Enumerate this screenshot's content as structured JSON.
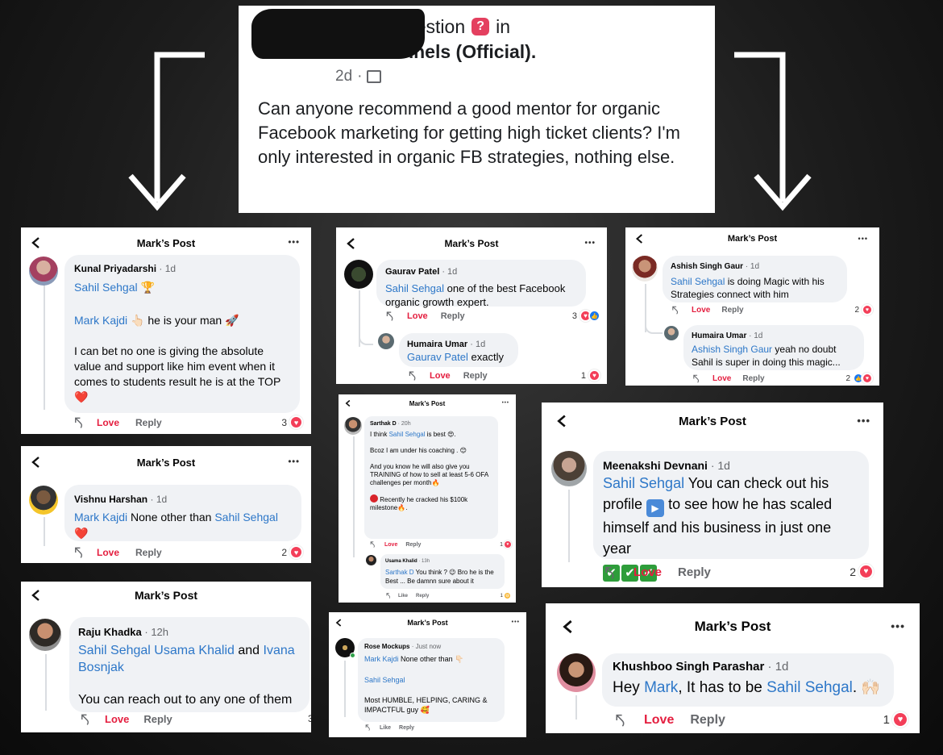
{
  "question": {
    "author_suffix": "sked a question",
    "in_text": "in",
    "group": "ClickFunnels (Official).",
    "age": "2d",
    "body": "Can anyone recommend a good mentor for organic Facebook marketing for getting high ticket clients? I'm only interested in organic FB strategies, nothing else."
  },
  "post_title": "Mark’s Post",
  "more_label": "•••",
  "love_label": "Love",
  "reply_label": "Reply",
  "like_label": "Like",
  "cards": {
    "kunal": {
      "name": "Kunal Priyadarshi",
      "time": "· 1d",
      "mention1": "Sahil Sehgal",
      "emoji1": "🏆",
      "mention2": "Mark Kajdi",
      "text2": "👆🏻 he is your man 🚀",
      "text3": "I can bet no one is giving the absolute value and support like him event when it comes to students result he is at the TOP ❤️",
      "count": "3"
    },
    "vishnu": {
      "name": "Vishnu Harshan",
      "time": "· 1d",
      "mention1": "Mark Kajdi",
      "text": "None other than",
      "mention2": "Sahil Sehgal",
      "emoji": "❤️",
      "count": "2"
    },
    "raju": {
      "name": "Raju Khadka",
      "time": "· 12h",
      "mention1": "Sahil Sehgal",
      "mention2": "Usama Khalid",
      "and_text": "and",
      "mention3": "Ivana Bosnjak",
      "text": "You can reach out to any one of them",
      "count": "3"
    },
    "gaurav": {
      "name": "Gaurav Patel",
      "time": "· 1d",
      "mention": "Sahil Sehgal",
      "text": "one of the best Facebook organic growth expert.",
      "count": "3",
      "reply_name": "Humaira Umar",
      "reply_time": "· 1d",
      "reply_mention": "Gaurav Patel",
      "reply_text": "exactly",
      "reply_count": "1"
    },
    "sarthak": {
      "name": "Sarthak D",
      "time": "· 20h",
      "t1a": "I think",
      "t1m": "Sahil Sehgal",
      "t1b": "is best 😍.",
      "t2": "Bcoz I am under his coaching . 😊",
      "t3": "And you know he will also give you TRAINING of how to sell at least 5-6 OFA challenges per month🔥",
      "t4": "Recently he cracked his $100k milestone🔥.",
      "count": "1",
      "reply_name": "Usama Khalid",
      "reply_time": "· 13h",
      "reply_mention": "Sarthak D",
      "reply_text": "You think ? 😉 Bro he is the Best ... Be damnn sure about it",
      "reply_count": "1"
    },
    "rose": {
      "name": "Rose Mockups",
      "time": "· Just now",
      "mention1": "Mark Kajdi",
      "text1": "None other than 👇🏻",
      "mention2": "Sahil Sehgal",
      "text2": "Most HUMBLE, HELPING, CARING & IMPACTFUL guy 🥰"
    },
    "ashish": {
      "name": "Ashish Singh Gaur",
      "time": "· 1d",
      "mention": "Sahil Sehgal",
      "text": "is doing Magic with his Strategies connect with him",
      "count": "2",
      "reply_name": "Humaira Umar",
      "reply_time": "· 1d",
      "reply_mention": "Ashish Singh Gaur",
      "reply_text": "yeah no doubt Sahil is super in doing this magic...",
      "reply_count": "2"
    },
    "meenakshi": {
      "name": "Meenakshi Devnani",
      "time": "· 1d",
      "mention": "Sahil Sehgal",
      "text1": "You can check out his profile",
      "text2": "to see how he has scaled himself and his business in just one year",
      "count": "2"
    },
    "khushboo": {
      "name": "Khushboo Singh Parashar",
      "time": "· 1d",
      "text1": "Hey",
      "mention1": "Mark",
      "text2": ", It has to be",
      "mention2": "Sahil Sehgal",
      "text3": ". 🙌🏻",
      "count": "1"
    }
  },
  "colors": {
    "link": "#2d77c8",
    "love": "#e41e3f",
    "bubble": "#f0f2f5"
  }
}
